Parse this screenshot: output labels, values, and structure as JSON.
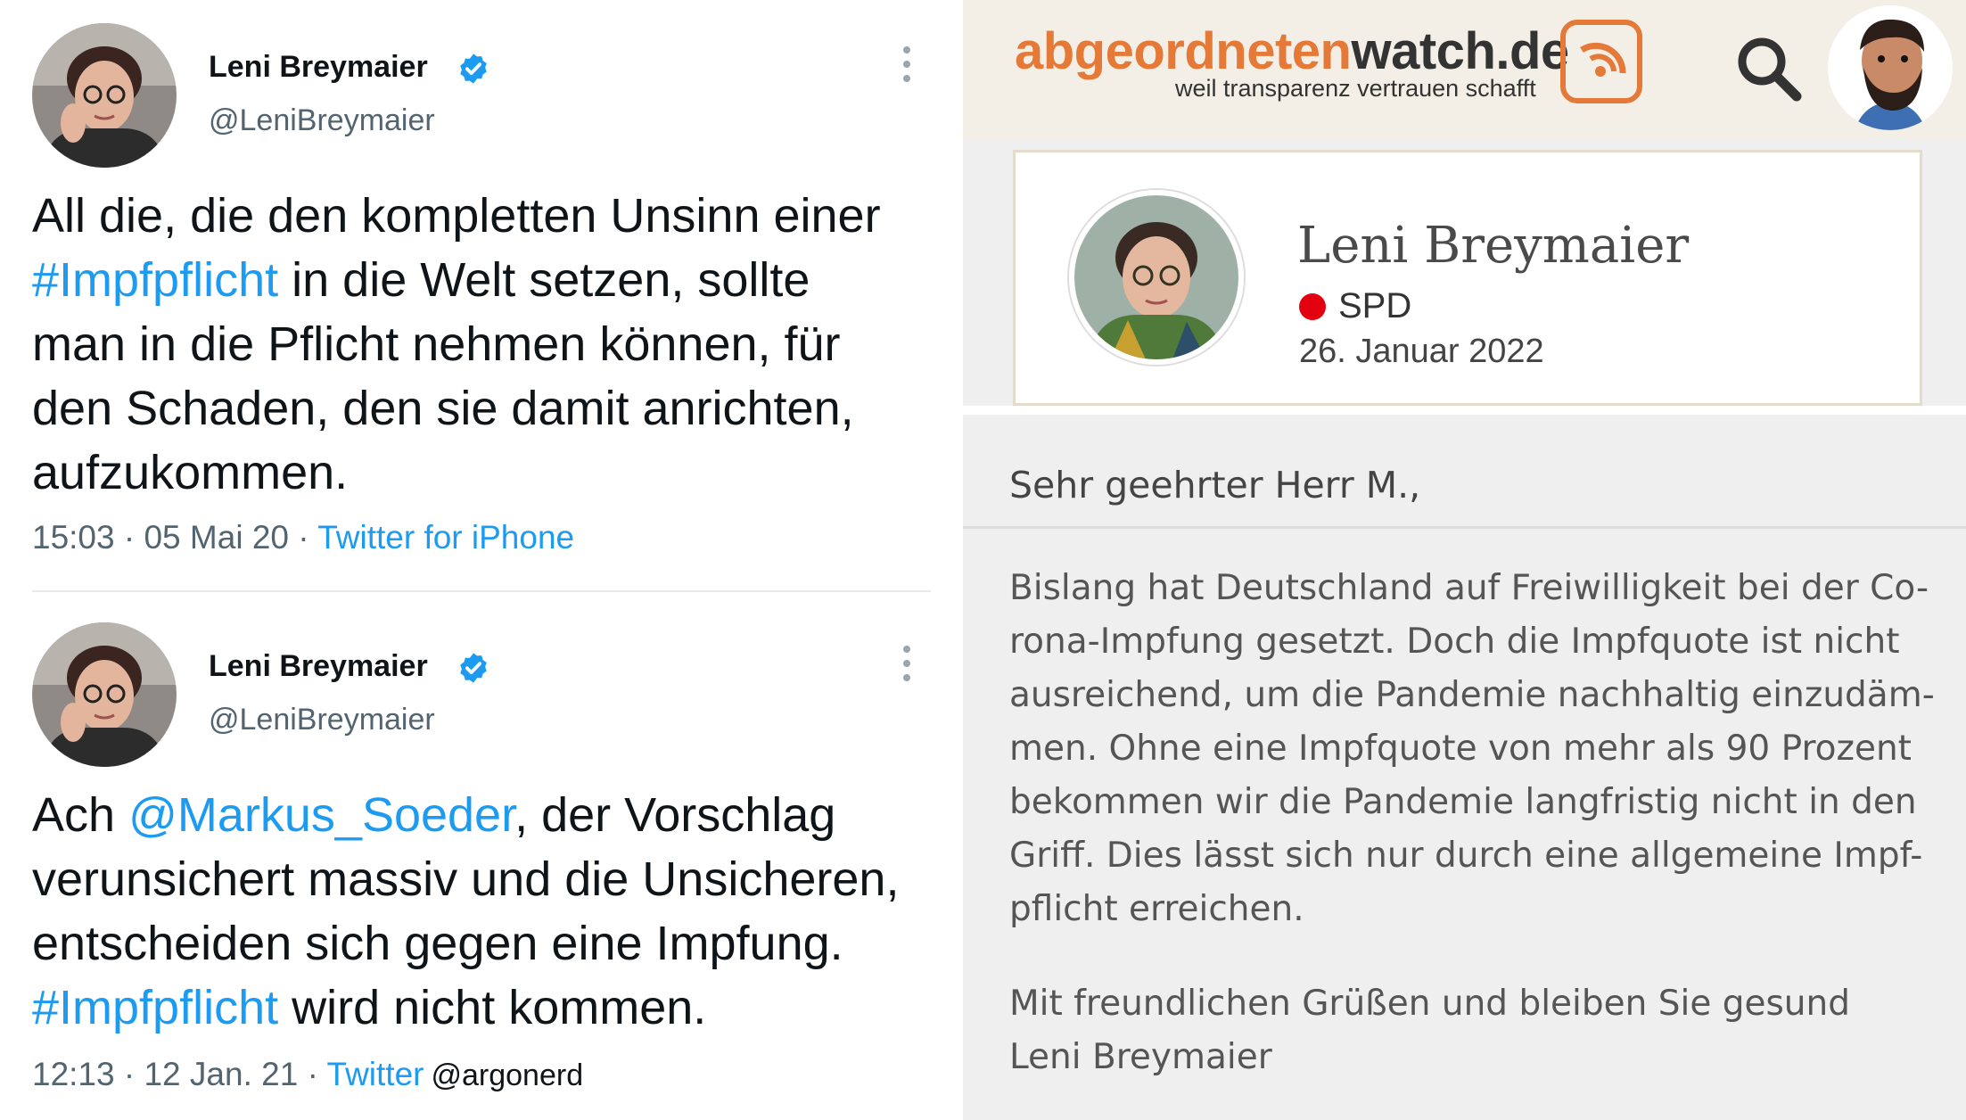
{
  "tweets": [
    {
      "display_name": "Leni Breymaier",
      "handle": "@LeniBreymaier",
      "text_lines": [
        [
          {
            "t": "All die, die den kompletten Unsinn einer"
          }
        ],
        [
          {
            "t": "#Impfpflicht",
            "tag": true
          },
          {
            "t": " in die Welt setzen, sollte"
          }
        ],
        [
          {
            "t": "man in die Pflicht nehmen können, für"
          }
        ],
        [
          {
            "t": "den Schaden, den sie damit anrichten,"
          }
        ],
        [
          {
            "t": "aufzukommen."
          }
        ]
      ],
      "time": "15:03",
      "date": "05 Mai 20",
      "source": "Twitter for iPhone"
    },
    {
      "display_name": "Leni Breymaier",
      "handle": "@LeniBreymaier",
      "text_lines": [
        [
          {
            "t": "Ach "
          },
          {
            "t": "@Markus_Soeder",
            "tag": true
          },
          {
            "t": ", der Vorschlag"
          }
        ],
        [
          {
            "t": "verunsichert massiv und die Unsicheren,"
          }
        ],
        [
          {
            "t": "entscheiden sich gegen eine Impfung."
          }
        ],
        [
          {
            "t": "#Impfpflicht",
            "tag": true
          },
          {
            "t": " wird nicht kommen."
          }
        ]
      ],
      "time": "12:13",
      "date": "12 Jan. 21",
      "source": "Twitter",
      "watermark": "@argonerd"
    }
  ],
  "site": {
    "logo_part1": "abgeordneten",
    "logo_part2": "watch.de",
    "tagline": "weil transparenz vertrauen schafft",
    "colors": {
      "accent": "#e57a38",
      "party": "#e3000f",
      "link": "#1d9bf0"
    }
  },
  "profile": {
    "name": "Leni Breymaier",
    "party": "SPD",
    "date": "26. Januar 2022"
  },
  "answer": {
    "salutation": "Sehr geehrter Herr M.,",
    "body_lines": [
      "Bislang hat Deutschland auf Freiwilligkeit bei der Co-",
      "rona-Impfung gesetzt. Doch die Impfquote ist nicht",
      "ausreichend, um die Pandemie nachhaltig einzudäm-",
      "men. Ohne eine Impfquote von mehr als 90 Prozent",
      "bekommen wir die Pandemie langfristig nicht in den",
      "Griff. Dies lässt sich nur durch eine allgemeine Impf-",
      "pflicht erreichen."
    ],
    "closing_lines": [
      "Mit freundlichen Grüßen und bleiben Sie gesund",
      "Leni Breymaier"
    ]
  }
}
